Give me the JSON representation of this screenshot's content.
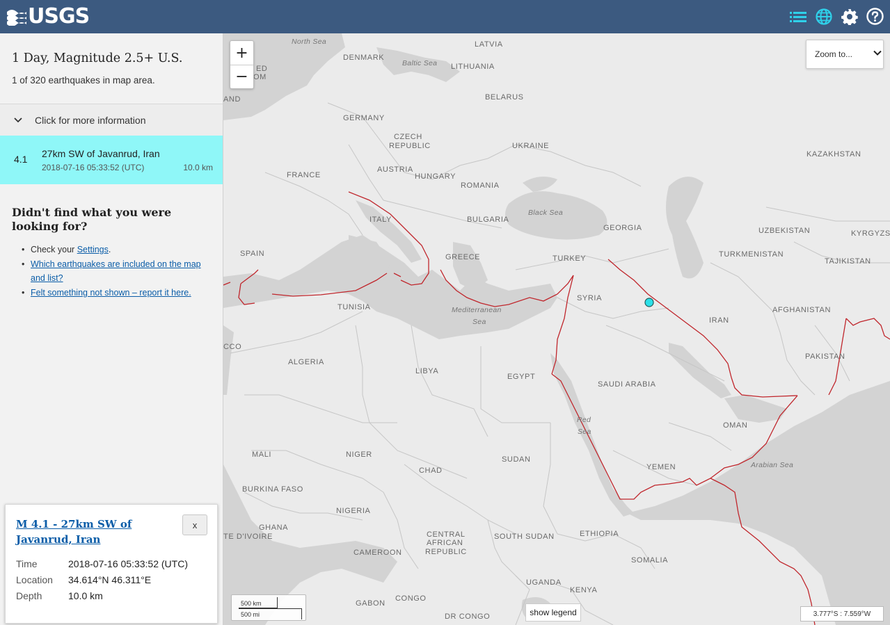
{
  "header": {
    "logo_text": "USGS",
    "icons": [
      "list-icon",
      "globe-icon",
      "gear-icon",
      "help-icon"
    ],
    "background": "#3c5a80",
    "accent": "#2fd1ea"
  },
  "panel": {
    "title": "1 Day, Magnitude 2.5+ U.S.",
    "count": "1 of 320 earthquakes in map area.",
    "more_info_label": "Click for more information",
    "earthquake": {
      "magnitude": "4.1",
      "place": "27km SW of Javanrud, Iran",
      "time": "2018-07-16 05:33:52 (UTC)",
      "depth": "10.0 km",
      "highlight_color": "#8ff7f8"
    },
    "didnt_find": "Didn't find what you were looking for?",
    "help_items": [
      {
        "prefix": "Check your ",
        "link": "Settings",
        "suffix": "."
      },
      {
        "prefix": "",
        "link": "Which earthquakes are included on the map and list?",
        "suffix": ""
      },
      {
        "prefix": "",
        "link": "Felt something not shown – report it here.",
        "suffix": ""
      }
    ]
  },
  "popup": {
    "title": "M 4.1 - 27km SW of Javanrud, Iran",
    "close_label": "x",
    "rows": [
      {
        "key": "Time",
        "value": "2018-07-16 05:33:52 (UTC)"
      },
      {
        "key": "Location",
        "value": "34.614°N 46.311°E"
      },
      {
        "key": "Depth",
        "value": "10.0 km"
      }
    ]
  },
  "map": {
    "zoom_in": "+",
    "zoom_out": "−",
    "zoom_to_label": "Zoom to...",
    "scale_km": "500 km",
    "scale_mi": "500 mi",
    "legend_button": "show legend",
    "coords": "3.777°S : 7.559°W",
    "country_labels": [
      "DENMARK",
      "LATVIA",
      "LITHUANIA",
      "BELARUS",
      "GERMANY",
      "CZECH",
      "REPUBLIC",
      "UKRAINE",
      "KAZAKHSTAN",
      "FRANCE",
      "AUSTRIA",
      "HUNGARY",
      "ROMANIA",
      "ITALY",
      "BULGARIA",
      "GEORGIA",
      "UZBEKISTAN",
      "KYRGYZS",
      "SPAIN",
      "GREECE",
      "TURKEY",
      "TURKMENISTAN",
      "TAJIKISTAN",
      "TUNISIA",
      "SYRIA",
      "IRAN",
      "AFGHANISTAN",
      "PAKISTAN",
      "ALGERIA",
      "LIBYA",
      "EGYPT",
      "SAUDI ARABIA",
      "OMAN",
      "MALI",
      "NIGER",
      "CHAD",
      "SUDAN",
      "YEMEN",
      "BURKINA FASO",
      "NIGERIA",
      "GHANA",
      "CENTRAL",
      "AFRICAN",
      "REPUBLIC",
      "SOUTH SUDAN",
      "ETHIOPIA",
      "CAMEROON",
      "SOMALIA",
      "UGANDA",
      "KENYA",
      "GABON",
      "CONGO",
      "DR CONGO",
      "TE D'IVOIRE",
      "ED",
      "OM",
      "AND",
      "CCO"
    ],
    "sea_labels": [
      "North Sea",
      "Baltic Sea",
      "Black Sea",
      "Mediterranean",
      "Sea",
      "Red",
      "Sea",
      "Arabian Sea"
    ],
    "marker_color": "#2be0e8",
    "fault_color": "#c0262c"
  }
}
